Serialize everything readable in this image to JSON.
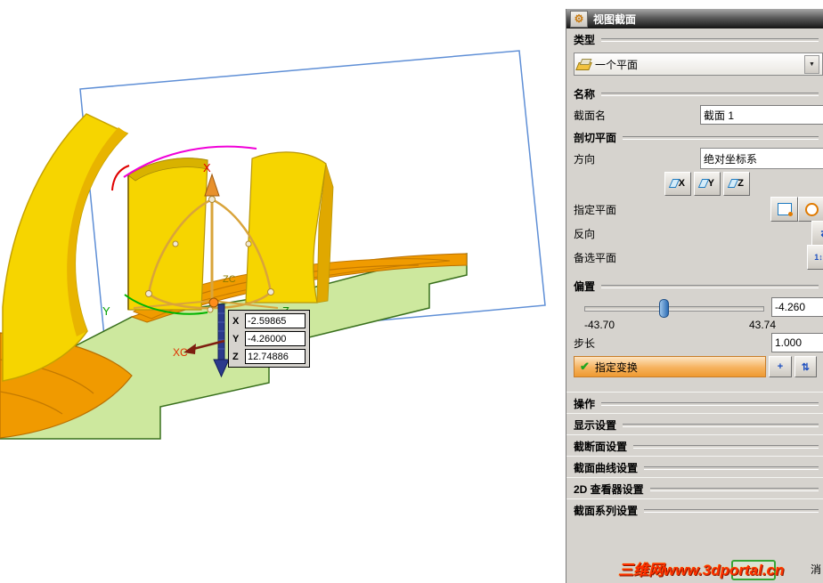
{
  "dialog": {
    "title": "视图截面",
    "type": {
      "header": "类型",
      "value": "一个平面"
    },
    "name": {
      "header": "名称",
      "label": "截面名",
      "value": "截面 1"
    },
    "plane": {
      "header": "剖切平面",
      "direction_label": "方向",
      "direction_value": "绝对坐标系",
      "axis_buttons": [
        "X",
        "Y",
        "Z"
      ],
      "specify_label": "指定平面",
      "reverse_label": "反向",
      "alternate_label": "备选平面"
    },
    "offset": {
      "header": "偏置",
      "value": "-4.260",
      "min": "-43.70",
      "max": "43.74",
      "step_label": "步长",
      "step_value": "1.000",
      "transform_label": "指定变换"
    },
    "groups": [
      "操作",
      "显示设置",
      "截断面设置",
      "截面曲线设置",
      "2D 查看器设置",
      "截面系列设置"
    ],
    "cancel_partial": "消"
  },
  "viewport": {
    "labels": {
      "x": "X",
      "y": "Y",
      "z": "Z",
      "zc": "ZC",
      "xc": "XC"
    },
    "readout": {
      "x": "-2.59865",
      "y": "-4.26000",
      "z": "12.74886"
    }
  },
  "watermark": "三维网www.3dportal.cn",
  "colors": {
    "highlight_orange": "#f0a040",
    "check_green": "#1fa51f",
    "slider_blue": "#2e6db4",
    "section_green": "#cde89e",
    "model_yellow": "#f6d500",
    "model_orange": "#f09a00",
    "wire_blue": "#5f8fd6",
    "watermark_red": "#ff3000"
  }
}
